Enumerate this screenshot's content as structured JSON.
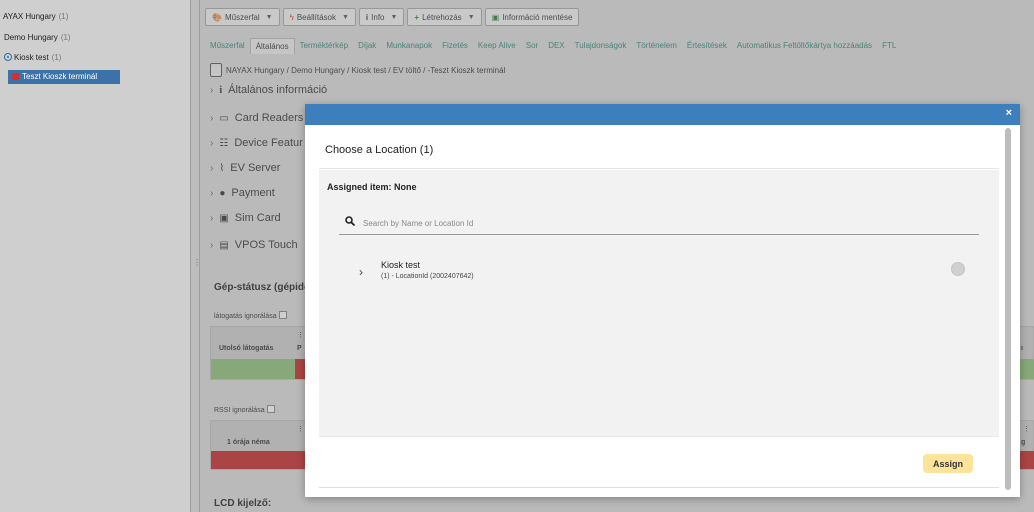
{
  "tree": {
    "items": [
      {
        "label": "AYAX Hungary",
        "count": "(1)"
      },
      {
        "label": "Demo Hungary",
        "count": "(1)"
      },
      {
        "label": "Kiosk test",
        "count": "(1)"
      }
    ],
    "selected": "Teszt Kioszk terminál"
  },
  "toolbar": {
    "buttons": [
      {
        "label": "Műszerfal",
        "icon": "dashboard-icon"
      },
      {
        "label": "Beállítások",
        "icon": "lightning-icon"
      },
      {
        "label": "Info",
        "icon": "info-icon"
      },
      {
        "label": "Létrehozás",
        "icon": "plus-icon"
      },
      {
        "label": "Információ mentése",
        "icon": "save-icon"
      }
    ]
  },
  "tabs": [
    "Műszerfal",
    "Általános",
    "Terméktérkép",
    "Díjak",
    "Munkanapok",
    "Fizetés",
    "Keep Alive",
    "Sor",
    "DEX",
    "Tulajdonságok",
    "Történelem",
    "Értesítések",
    "Automatikus Feltöltőkártya hozzáadás",
    "FTL"
  ],
  "active_tab": "Általános",
  "breadcrumb": "NAYAX Hungary / Demo Hungary / Kiosk test / EV töltő / -Teszt Kioszk terminál",
  "sections": [
    {
      "label": "Általános információ",
      "icon": "info-icon"
    },
    {
      "label": "Card Readers",
      "icon": "card-reader-icon"
    },
    {
      "label": "Device Featur",
      "icon": "list-icon"
    },
    {
      "label": "EV Server",
      "icon": "antenna-icon"
    },
    {
      "label": "Payment",
      "icon": "payment-icon"
    },
    {
      "label": "Sim Card",
      "icon": "sim-icon"
    },
    {
      "label": "VPOS Touch",
      "icon": "terminal-icon"
    }
  ],
  "status": {
    "title": "Gép-státusz (gépidő",
    "ignore_visit": "látogatás ignorálása",
    "last_visit": "Utolsó látogatás",
    "col_p": "P",
    "rssi_ignore": "RSSI ignorálása",
    "silent_hour": "1 órája néma",
    "right_trunc_1": "ı",
    "right_trunc_2": "g",
    "lcd": "LCD kijelző:"
  },
  "modal": {
    "title": "Choose a Location (1)",
    "assigned": "Assigned item: None",
    "search_placeholder": "Search by Name or Location Id",
    "location_name": "Kiosk test",
    "location_sub": "(1) - LocationId (2002407642)",
    "assign_label": "Assign",
    "close": "×"
  },
  "colors": {
    "modal_header": "#3d7fbd",
    "assign_button": "#fde49a",
    "tab_link": "#2e8b78",
    "status_red": "#c62828",
    "status_green": "#8fc47a"
  }
}
